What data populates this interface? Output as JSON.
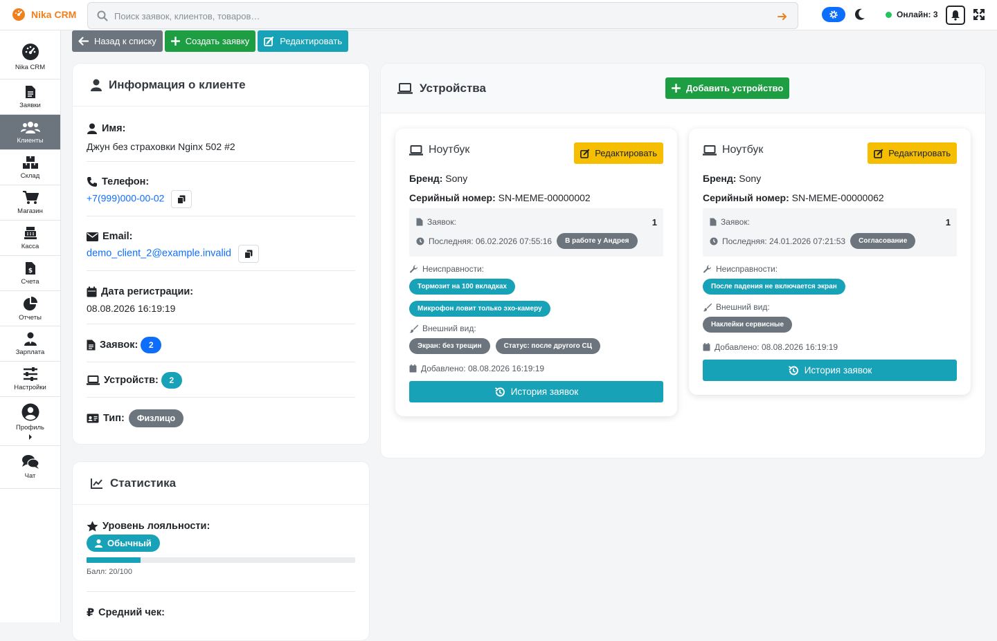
{
  "app": {
    "title": "Nika CRM"
  },
  "search": {
    "placeholder": "Поиск заявок, клиентов, товаров…"
  },
  "header": {
    "online_label": "Онлайн: 3"
  },
  "sidebar": {
    "items": [
      {
        "label": "Nika CRM",
        "icon": "dashboard-gauge-icon"
      },
      {
        "label": "Заявки",
        "icon": "file-icon"
      },
      {
        "label": "Клиенты",
        "icon": "users-icon"
      },
      {
        "label": "Склад",
        "icon": "boxes-icon"
      },
      {
        "label": "Магазин",
        "icon": "cart-icon"
      },
      {
        "label": "Касса",
        "icon": "cash-register-icon"
      },
      {
        "label": "Счета",
        "icon": "invoice-icon"
      },
      {
        "label": "Отчеты",
        "icon": "pie-chart-icon"
      },
      {
        "label": "Зарплата",
        "icon": "user-tie-icon"
      },
      {
        "label": "Настройки",
        "icon": "sliders-icon"
      },
      {
        "label": "Профиль",
        "icon": "user-circle-icon"
      },
      {
        "label": "Чат",
        "icon": "chat-icon"
      }
    ]
  },
  "toolbar": {
    "back_label": "Назад к списку",
    "create_label": "Создать заявку",
    "edit_label": "Редактировать"
  },
  "client": {
    "title": "Информация о клиенте",
    "name_label": "Имя:",
    "name": "Джун без страховки Nginx 502 #2",
    "phone_label": "Телефон:",
    "phone": "+7(999)000-00-02",
    "email_label": "Email:",
    "email": "demo_client_2@example.invalid",
    "reg_label": "Дата регистрации:",
    "reg_date": "08.08.2026 16:19:19",
    "orders_label": "Заявок:",
    "orders_count": "2",
    "devices_label": "Устройств:",
    "devices_count": "2",
    "type_label": "Тип:",
    "type_value": "Физлицо"
  },
  "stats": {
    "title": "Статистика",
    "loyalty_label": "Уровень лояльности:",
    "loyalty_value": "Обычный",
    "score_text": "Балл: 20/100",
    "score_fraction": 0.2,
    "avg_check_label": "Средний чек:"
  },
  "devices": {
    "title": "Устройства",
    "add_label": "Добавить устройство",
    "items": [
      {
        "title": "Ноутбук",
        "edit_label": "Редактировать",
        "brand_label": "Бренд:",
        "brand": "Sony",
        "serial_label": "Серийный номер:",
        "serial": "SN-MEME-00000002",
        "requests_label": "Заявок:",
        "requests_count": "1",
        "last_label": "Последняя: 06.02.2026 07:55:16",
        "status": "В работе у Андрея",
        "faults_label": "Неисправности:",
        "faults": [
          "Тормозит на 100 вкладках",
          "Микрофон ловит только эхо-камеру"
        ],
        "look_label": "Внешний вид:",
        "looks": [
          "Экран: без трещин",
          "Статус: после другого СЦ"
        ],
        "added": "Добавлено: 08.08.2026 16:19:19",
        "history_label": "История заявок"
      },
      {
        "title": "Ноутбук",
        "edit_label": "Редактировать",
        "brand_label": "Бренд:",
        "brand": "Sony",
        "serial_label": "Серийный номер:",
        "serial": "SN-MEME-00000062",
        "requests_label": "Заявок:",
        "requests_count": "1",
        "last_label": "Последняя: 24.01.2026 07:21:53",
        "status": "Согласование",
        "faults_label": "Неисправности:",
        "faults": [
          "После падения не включается экран"
        ],
        "look_label": "Внешний вид:",
        "looks": [
          "Наклейки сервисные"
        ],
        "added": "Добавлено: 08.08.2026 16:19:19",
        "history_label": "История заявок"
      }
    ]
  },
  "colors": {
    "brand": "#f07f1e",
    "primary": "#0d6efd",
    "success": "#1e9e43",
    "info": "#17a2b8",
    "warning": "#f5be00",
    "secondary": "#6c757d"
  }
}
